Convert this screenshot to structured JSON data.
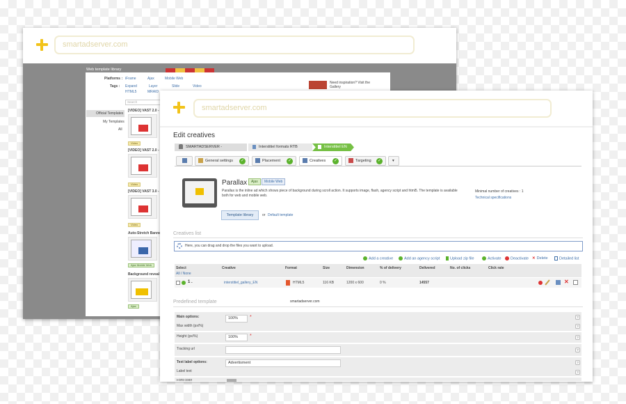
{
  "back_window": {
    "url": "smartadserver.com",
    "panel_title": "Web template library",
    "filters": {
      "platforms_label": "Platforms :",
      "platforms": [
        "iFrame",
        "Ajax",
        "Mobile Web"
      ],
      "tags_label": "Tags :",
      "tags": [
        "Expand",
        "Layer",
        "Slide",
        "Video",
        "HTML5",
        "MRAID"
      ]
    },
    "inspiration": "Need inspiration? Visit the Gallery",
    "search_placeholder": "Search",
    "sidebar": [
      "Official Templates",
      "My Templates",
      "All"
    ],
    "cards": [
      {
        "title": "[VIDEO] VAST 2.0 - LI",
        "badge": "Video"
      },
      {
        "title": "[VIDEO] VAST 2.0 - WI",
        "badge": "Video"
      },
      {
        "title": "[VIDEO] VAST 3.0 - WI",
        "badge": "Video"
      },
      {
        "title": "Auto-Stretch Banner",
        "badge": "Ajax  Mobile Web"
      },
      {
        "title": "Background reveal",
        "badge": "Ajax"
      }
    ]
  },
  "front_window": {
    "url": "smartadserver.com",
    "heading": "Edit creatives",
    "breadcrumb": [
      "SMARTADSERVER -",
      "Interstitiel formats RTB",
      "Interstitiel EN"
    ],
    "tabs": [
      {
        "label": ""
      },
      {
        "label": "General settings"
      },
      {
        "label": "Placement"
      },
      {
        "label": "Creatives"
      },
      {
        "label": "Targeting"
      },
      {
        "label": "▾"
      }
    ],
    "template": {
      "name": "Parallax",
      "tags": [
        "Ajax",
        "Mobile Web"
      ],
      "description": "Parallax is the inline ad which shows piece of background during scroll action. It supports image, flash, agency script and html5. The template is available both for web and mobile web.",
      "min_creatives": "Minimal number of creatives : 1",
      "tech_specs": "Technical specifications",
      "library_button": "Template library",
      "or": "or",
      "default_link": "Default template"
    },
    "creatives_list_title": "Creatives list",
    "dropzone_text": "Here, you can drag and drop the files you want to upload.",
    "actions": [
      "Add a creative",
      "Add an agency script",
      "Upload zip file",
      "Activate",
      "Deactivate",
      "Delete",
      "Detailed list"
    ],
    "table": {
      "headers": [
        "Select",
        "Creative",
        "Format",
        "Size",
        "Dimension",
        "% of delivery",
        "Delivered",
        "No. of clicks",
        "Click rate"
      ],
      "select_sub": "All / None",
      "row": {
        "index": "1 .",
        "creative": "interstitiel_gallery_EN",
        "format": "HTML5",
        "size": "116 KB",
        "dimension": "1200 x 600",
        "delivery": "0 %",
        "delivered": "14557"
      }
    },
    "predefined_title": "Predefined template",
    "predefined_source": "smartadserver.com",
    "form": [
      {
        "label": "Main options:",
        "bold": true
      },
      {
        "label": "Max width (px/%)",
        "value": "100%"
      },
      {
        "label": "Height (px/%)",
        "value": "100%"
      },
      {
        "label": "Tracking url",
        "value": ""
      },
      {
        "label": "Text label options:",
        "bold": true,
        "value": "Advertisment"
      },
      {
        "label": "Label text"
      },
      {
        "label": "Font color"
      }
    ]
  },
  "colors": {
    "accent_yellow": "#f2c31a",
    "link_blue": "#3d6ea8",
    "success_green": "#5bb22c",
    "danger_red": "#d33333"
  }
}
